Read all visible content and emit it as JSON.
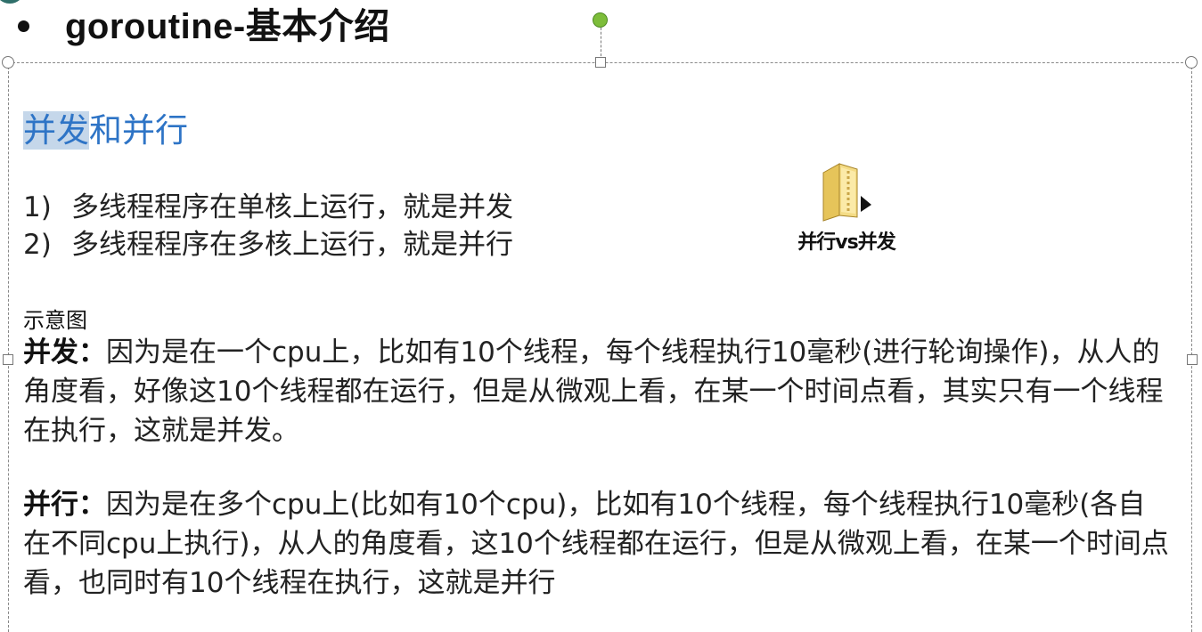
{
  "slide": {
    "title": "goroutine-基本介绍",
    "heading_selected": "并发",
    "heading_rest": "和并行",
    "list": [
      {
        "num": "1)",
        "text": "多线程程序在单核上运行，就是并发"
      },
      {
        "num": "2)",
        "text": "多线程程序在多核上运行，就是并行"
      }
    ],
    "file_label": "并行vs并发",
    "caption": "示意图",
    "concurrency": {
      "label": "并发：",
      "text": "因为是在一个cpu上，比如有10个线程，每个线程执行10毫秒(进行轮询操作)，从人的角度看，好像这10个线程都在运行，但是从微观上看，在某一个时间点看，其实只有一个线程在执行，这就是并发。"
    },
    "parallelism": {
      "label": "并行：",
      "text": "因为是在多个cpu上(比如有10个cpu)，比如有10个线程，每个线程执行10毫秒(各自在不同cpu上执行)，从人的角度看，这10个线程都在运行，但是从微观上看，在某一个时间点看，也同时有10个线程在执行，这就是并行"
    }
  },
  "icons": {
    "file": "folder-shortcut-icon",
    "bullet": "bullet-icon"
  },
  "colors": {
    "heading": "#2e74c6",
    "selection": "#c5d7ea",
    "rotate_handle": "#7dbd3a"
  }
}
